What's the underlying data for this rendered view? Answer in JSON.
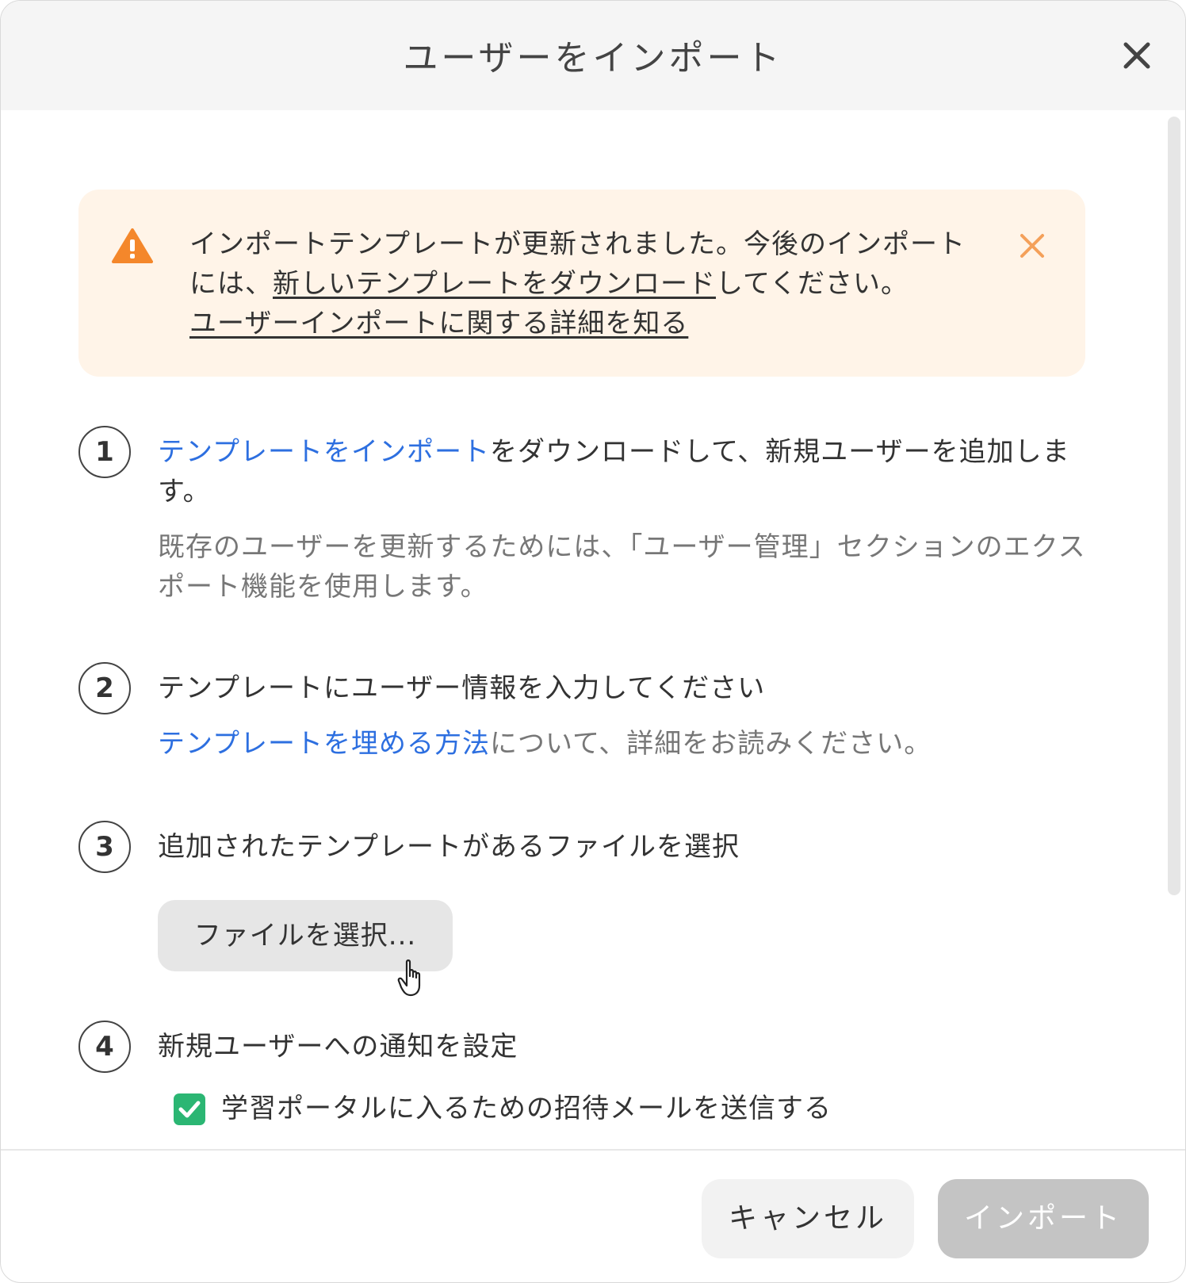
{
  "dialog": {
    "title": "ユーザーをインポート",
    "close_icon": "close-icon"
  },
  "banner": {
    "icon": "warning-icon",
    "text_part1": "インポートテンプレートが更新されました。今後のインポートには、",
    "download_link": "新しいテンプレートをダウンロード",
    "text_part2": "してください。",
    "learn_link": "ユーザーインポートに関する詳細を知る",
    "close_icon": "close-icon",
    "accent_color": "#f4872b"
  },
  "steps": [
    {
      "number": "1",
      "link": "テンプレートをインポート",
      "text": "をダウンロードして、新規ユーザーを追加します。",
      "sub": "既存のユーザーを更新するためには、「ユーザー管理」セクションのエクスポート機能を使用します。"
    },
    {
      "number": "2",
      "text": "テンプレートにユーザー情報を入力してください",
      "sub_link": "テンプレートを埋める方法",
      "sub_text": "について、詳細をお読みください。"
    },
    {
      "number": "3",
      "text": "追加されたテンプレートがあるファイルを選択",
      "button": "ファイルを選択..."
    },
    {
      "number": "4",
      "text": "新規ユーザーへの通知を設定",
      "checkbox_label": "学習ポータルに入るための招待メールを送信する",
      "checkbox_checked": true
    }
  ],
  "footer": {
    "cancel": "キャンセル",
    "import": "インポート"
  },
  "colors": {
    "link": "#2d6fe0",
    "checkbox": "#2bb673",
    "banner_bg": "#fff4e8",
    "disabled_button": "#c4c4c4"
  }
}
